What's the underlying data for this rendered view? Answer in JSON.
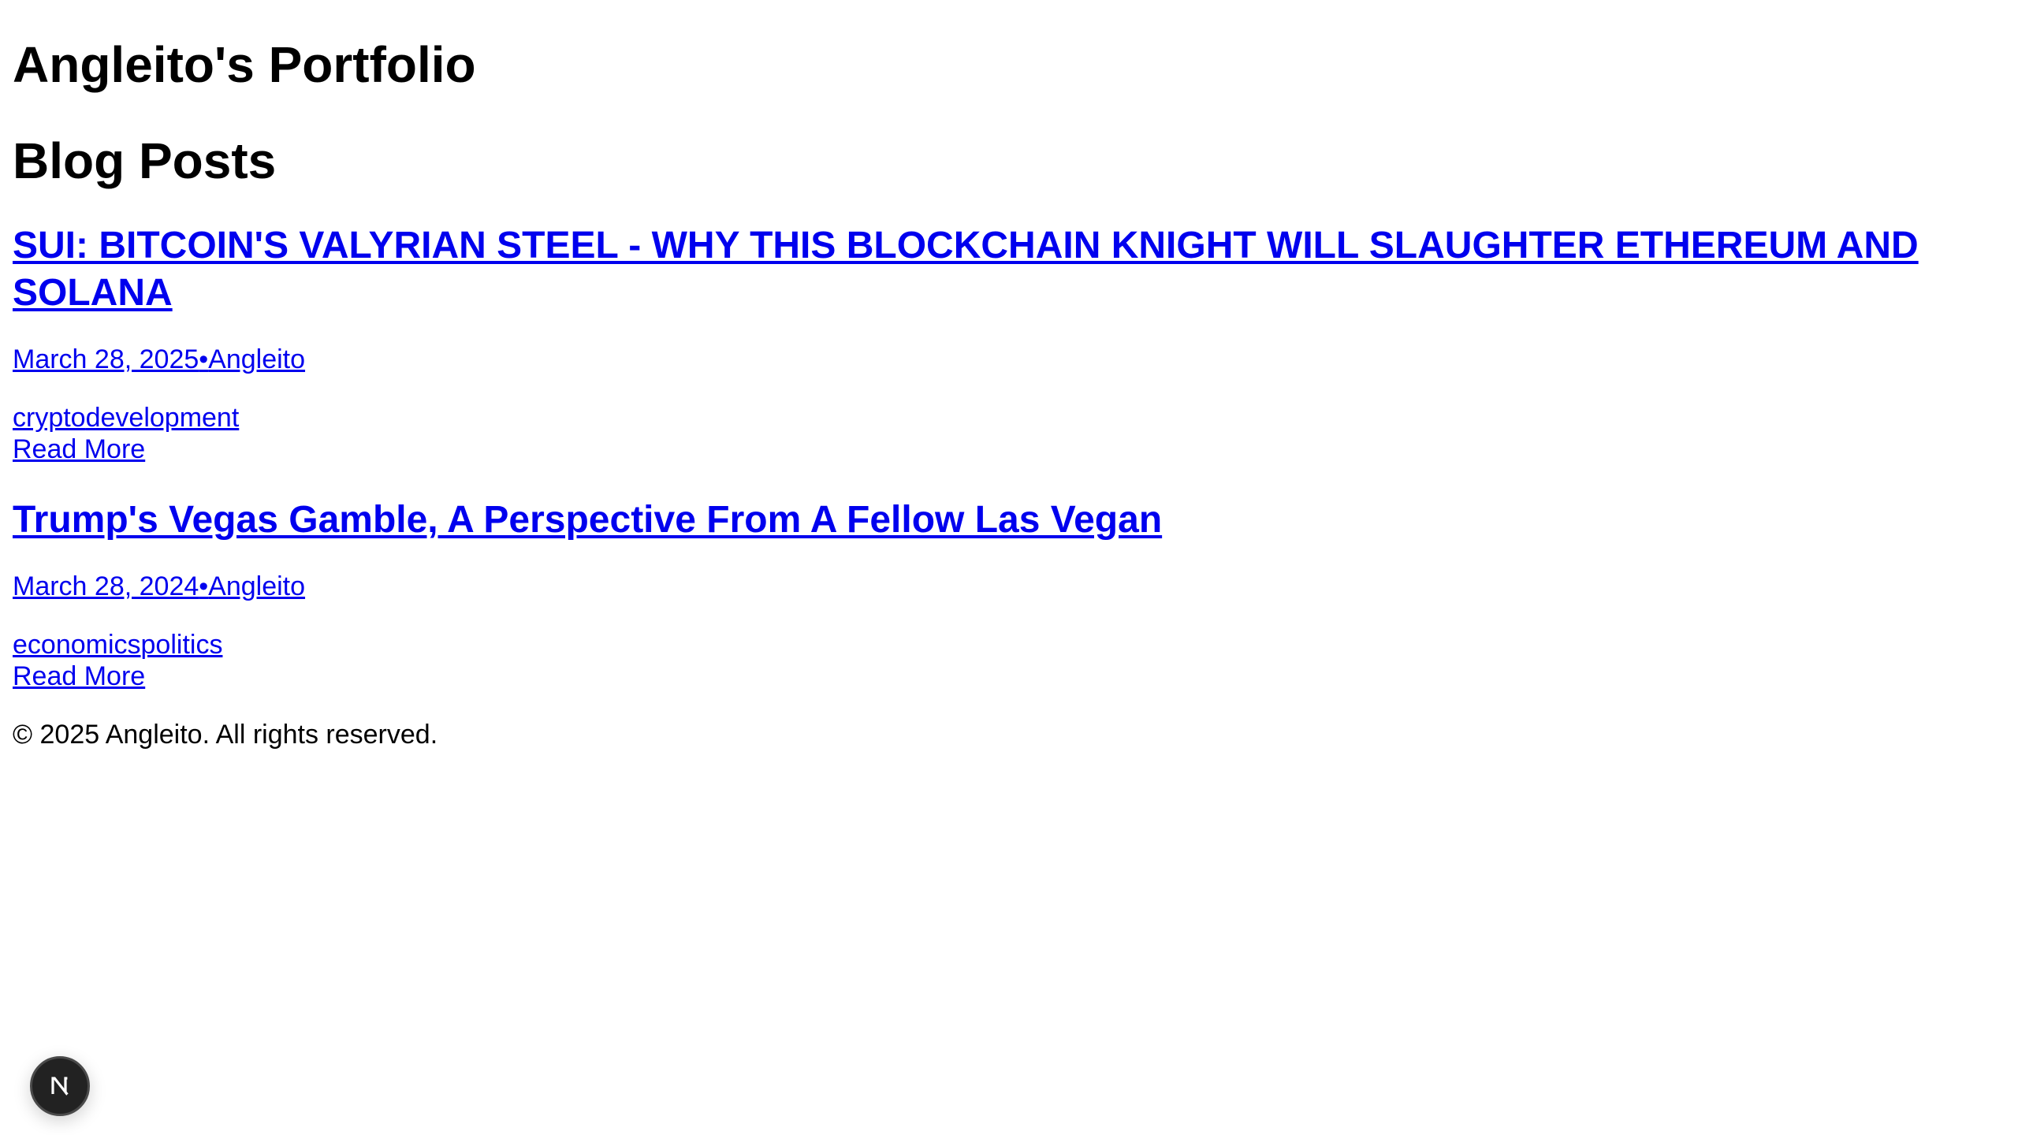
{
  "site": {
    "title": "Angleito's Portfolio"
  },
  "blog": {
    "section_title": "Blog Posts",
    "posts": [
      {
        "title": "SUI: BITCOIN'S VALYRIAN STEEL - WHY THIS BLOCKCHAIN KNIGHT WILL SLAUGHTER ETHEREUM AND SOLANA",
        "date": "March 28, 2025",
        "separator": "•",
        "author": "Angleito",
        "tags": [
          "crypto",
          "development"
        ],
        "read_more": "Read More"
      },
      {
        "title": "Trump's Vegas Gamble, A Perspective From A Fellow Las Vegan",
        "date": "March 28, 2024",
        "separator": "•",
        "author": "Angleito",
        "tags": [
          "economics",
          "politics"
        ],
        "read_more": "Read More"
      }
    ]
  },
  "footer": {
    "text": "© 2025 Angleito. All rights reserved."
  },
  "dev_badge": {
    "icon": "nextjs-logo-icon",
    "letter": "N"
  },
  "colors": {
    "link": "#0000ee",
    "text": "#000000",
    "background": "#ffffff",
    "badge": "#222222"
  }
}
